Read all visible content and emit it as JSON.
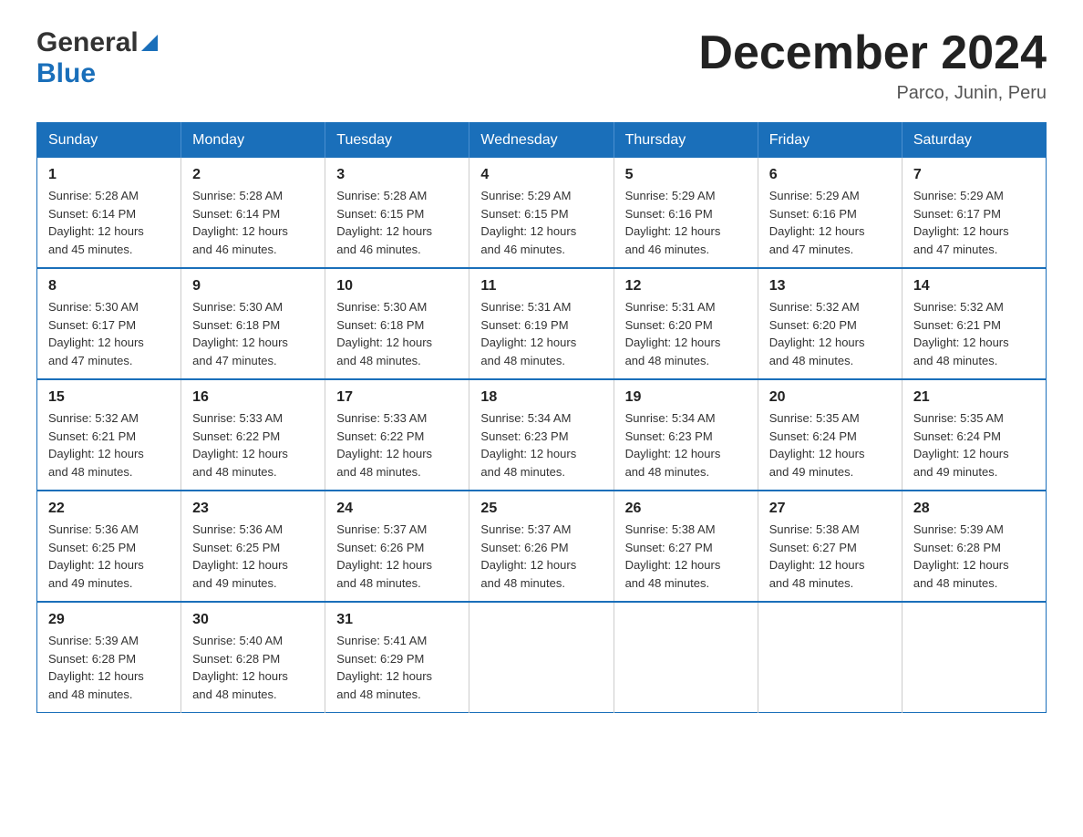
{
  "logo": {
    "general": "General",
    "blue": "Blue"
  },
  "header": {
    "title": "December 2024",
    "location": "Parco, Junin, Peru"
  },
  "days_of_week": [
    "Sunday",
    "Monday",
    "Tuesday",
    "Wednesday",
    "Thursday",
    "Friday",
    "Saturday"
  ],
  "weeks": [
    [
      {
        "day": "1",
        "sunrise": "5:28 AM",
        "sunset": "6:14 PM",
        "daylight": "12 hours and 45 minutes."
      },
      {
        "day": "2",
        "sunrise": "5:28 AM",
        "sunset": "6:14 PM",
        "daylight": "12 hours and 46 minutes."
      },
      {
        "day": "3",
        "sunrise": "5:28 AM",
        "sunset": "6:15 PM",
        "daylight": "12 hours and 46 minutes."
      },
      {
        "day": "4",
        "sunrise": "5:29 AM",
        "sunset": "6:15 PM",
        "daylight": "12 hours and 46 minutes."
      },
      {
        "day": "5",
        "sunrise": "5:29 AM",
        "sunset": "6:16 PM",
        "daylight": "12 hours and 46 minutes."
      },
      {
        "day": "6",
        "sunrise": "5:29 AM",
        "sunset": "6:16 PM",
        "daylight": "12 hours and 47 minutes."
      },
      {
        "day": "7",
        "sunrise": "5:29 AM",
        "sunset": "6:17 PM",
        "daylight": "12 hours and 47 minutes."
      }
    ],
    [
      {
        "day": "8",
        "sunrise": "5:30 AM",
        "sunset": "6:17 PM",
        "daylight": "12 hours and 47 minutes."
      },
      {
        "day": "9",
        "sunrise": "5:30 AM",
        "sunset": "6:18 PM",
        "daylight": "12 hours and 47 minutes."
      },
      {
        "day": "10",
        "sunrise": "5:30 AM",
        "sunset": "6:18 PM",
        "daylight": "12 hours and 48 minutes."
      },
      {
        "day": "11",
        "sunrise": "5:31 AM",
        "sunset": "6:19 PM",
        "daylight": "12 hours and 48 minutes."
      },
      {
        "day": "12",
        "sunrise": "5:31 AM",
        "sunset": "6:20 PM",
        "daylight": "12 hours and 48 minutes."
      },
      {
        "day": "13",
        "sunrise": "5:32 AM",
        "sunset": "6:20 PM",
        "daylight": "12 hours and 48 minutes."
      },
      {
        "day": "14",
        "sunrise": "5:32 AM",
        "sunset": "6:21 PM",
        "daylight": "12 hours and 48 minutes."
      }
    ],
    [
      {
        "day": "15",
        "sunrise": "5:32 AM",
        "sunset": "6:21 PM",
        "daylight": "12 hours and 48 minutes."
      },
      {
        "day": "16",
        "sunrise": "5:33 AM",
        "sunset": "6:22 PM",
        "daylight": "12 hours and 48 minutes."
      },
      {
        "day": "17",
        "sunrise": "5:33 AM",
        "sunset": "6:22 PM",
        "daylight": "12 hours and 48 minutes."
      },
      {
        "day": "18",
        "sunrise": "5:34 AM",
        "sunset": "6:23 PM",
        "daylight": "12 hours and 48 minutes."
      },
      {
        "day": "19",
        "sunrise": "5:34 AM",
        "sunset": "6:23 PM",
        "daylight": "12 hours and 48 minutes."
      },
      {
        "day": "20",
        "sunrise": "5:35 AM",
        "sunset": "6:24 PM",
        "daylight": "12 hours and 49 minutes."
      },
      {
        "day": "21",
        "sunrise": "5:35 AM",
        "sunset": "6:24 PM",
        "daylight": "12 hours and 49 minutes."
      }
    ],
    [
      {
        "day": "22",
        "sunrise": "5:36 AM",
        "sunset": "6:25 PM",
        "daylight": "12 hours and 49 minutes."
      },
      {
        "day": "23",
        "sunrise": "5:36 AM",
        "sunset": "6:25 PM",
        "daylight": "12 hours and 49 minutes."
      },
      {
        "day": "24",
        "sunrise": "5:37 AM",
        "sunset": "6:26 PM",
        "daylight": "12 hours and 48 minutes."
      },
      {
        "day": "25",
        "sunrise": "5:37 AM",
        "sunset": "6:26 PM",
        "daylight": "12 hours and 48 minutes."
      },
      {
        "day": "26",
        "sunrise": "5:38 AM",
        "sunset": "6:27 PM",
        "daylight": "12 hours and 48 minutes."
      },
      {
        "day": "27",
        "sunrise": "5:38 AM",
        "sunset": "6:27 PM",
        "daylight": "12 hours and 48 minutes."
      },
      {
        "day": "28",
        "sunrise": "5:39 AM",
        "sunset": "6:28 PM",
        "daylight": "12 hours and 48 minutes."
      }
    ],
    [
      {
        "day": "29",
        "sunrise": "5:39 AM",
        "sunset": "6:28 PM",
        "daylight": "12 hours and 48 minutes."
      },
      {
        "day": "30",
        "sunrise": "5:40 AM",
        "sunset": "6:28 PM",
        "daylight": "12 hours and 48 minutes."
      },
      {
        "day": "31",
        "sunrise": "5:41 AM",
        "sunset": "6:29 PM",
        "daylight": "12 hours and 48 minutes."
      },
      null,
      null,
      null,
      null
    ]
  ],
  "labels": {
    "sunrise": "Sunrise:",
    "sunset": "Sunset:",
    "daylight": "Daylight:"
  },
  "colors": {
    "header_bg": "#1a6fba",
    "border": "#1a6fba"
  }
}
